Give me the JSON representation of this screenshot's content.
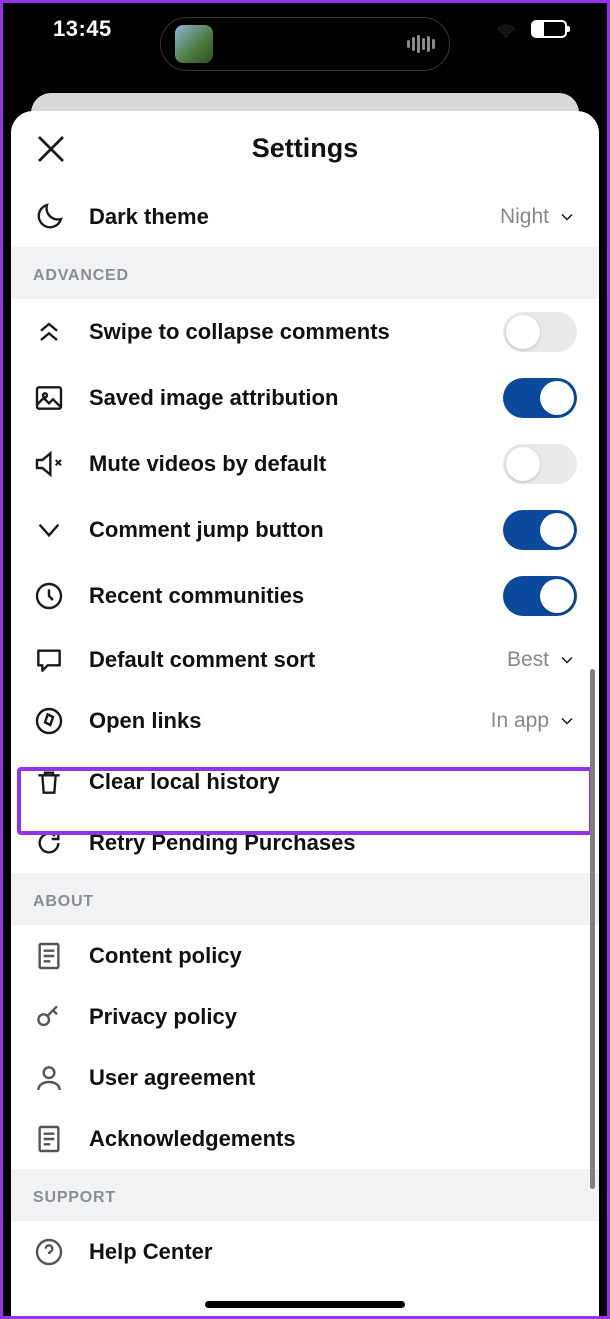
{
  "status": {
    "time": "13:45"
  },
  "header": {
    "title": "Settings"
  },
  "dark_theme": {
    "label": "Dark theme",
    "value": "Night"
  },
  "sections": {
    "advanced": {
      "title": "ADVANCED",
      "swipe_collapse": {
        "label": "Swipe to collapse comments",
        "on": false
      },
      "saved_attrib": {
        "label": "Saved image attribution",
        "on": true
      },
      "mute_videos": {
        "label": "Mute videos by default",
        "on": false
      },
      "jump_button": {
        "label": "Comment jump button",
        "on": true
      },
      "recent_comm": {
        "label": "Recent communities",
        "on": true
      },
      "comment_sort": {
        "label": "Default comment sort",
        "value": "Best"
      },
      "open_links": {
        "label": "Open links",
        "value": "In app"
      },
      "clear_history": {
        "label": "Clear local history"
      },
      "retry_purchases": {
        "label": "Retry Pending Purchases"
      }
    },
    "about": {
      "title": "ABOUT",
      "content_policy": {
        "label": "Content policy"
      },
      "privacy_policy": {
        "label": "Privacy policy"
      },
      "user_agreement": {
        "label": "User agreement"
      },
      "acknowledgements": {
        "label": "Acknowledgements"
      }
    },
    "support": {
      "title": "SUPPORT",
      "help_center": {
        "label": "Help Center"
      }
    }
  }
}
